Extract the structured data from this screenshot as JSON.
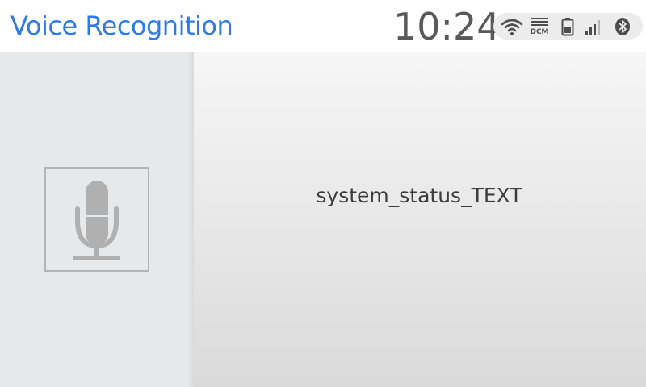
{
  "header": {
    "title": "Voice Recognition",
    "time": "10:24"
  },
  "status_bar": {
    "icons": [
      "wifi-icon",
      "dcm-icon",
      "battery-icon",
      "signal-icon",
      "bluetooth-icon"
    ],
    "dcm_label": "DCM"
  },
  "voice_panel": {
    "mic_icon": "microphone-icon"
  },
  "main": {
    "status_text": "system_status_TEXT"
  },
  "colors": {
    "title": "#2e7be6",
    "clock": "#595959",
    "icon_gray": "#b0b0b0"
  }
}
